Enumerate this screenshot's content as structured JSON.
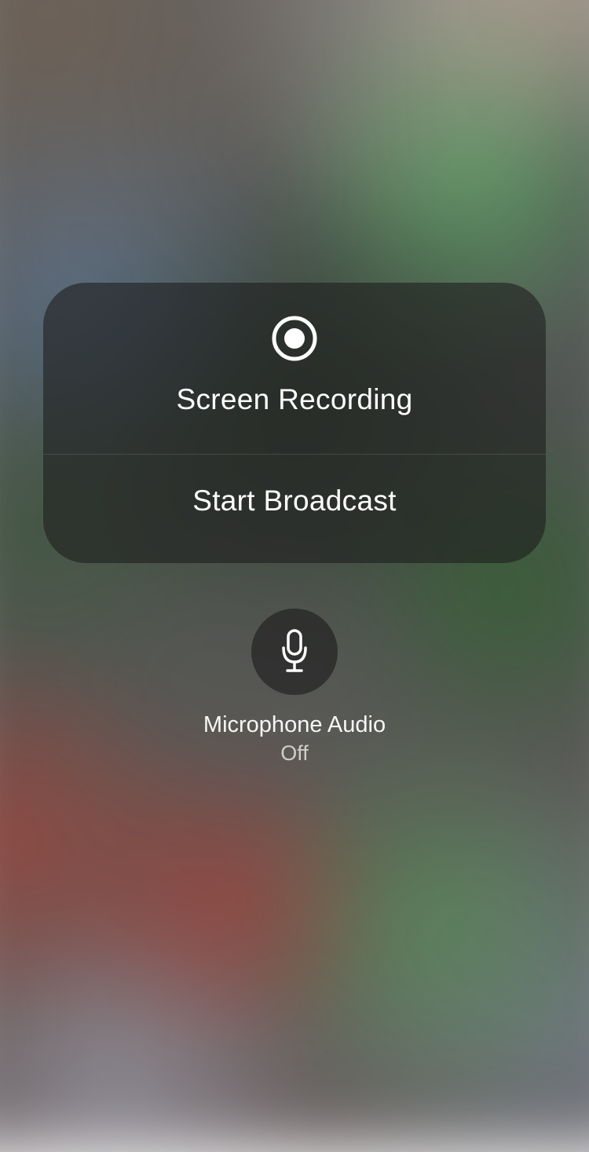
{
  "modal": {
    "title": "Screen Recording",
    "action_label": "Start Broadcast"
  },
  "microphone": {
    "title": "Microphone Audio",
    "status": "Off"
  }
}
